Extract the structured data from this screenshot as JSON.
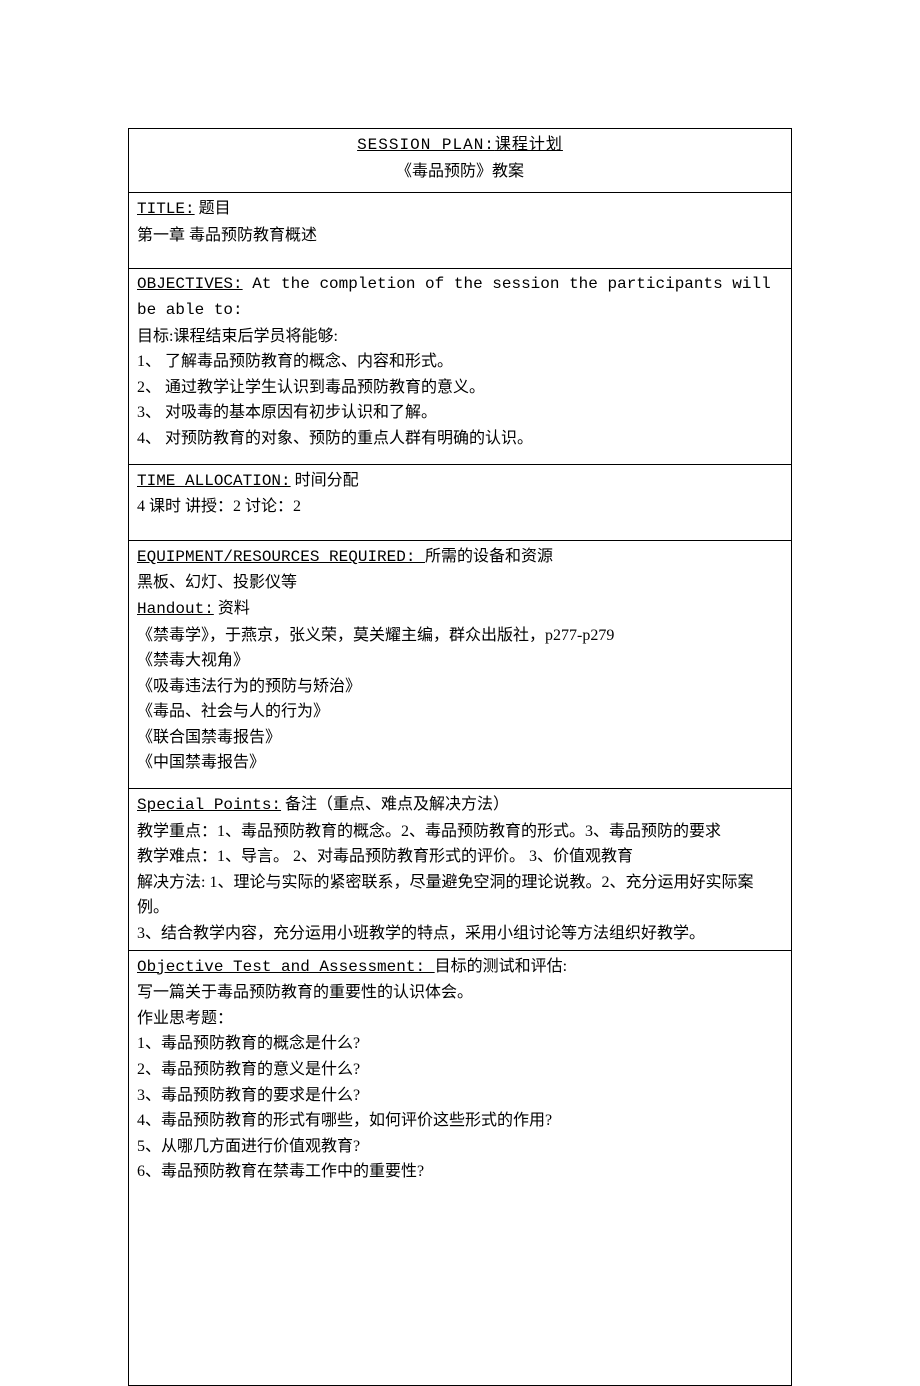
{
  "header": {
    "line1_pre": "SESSION   PLAN:",
    "line1_suf": "课程计划  ",
    "line2": "《毒品预防》教案"
  },
  "titleSection": {
    "label": "TITLE:",
    "label_cn": " 题目",
    "content": "第一章 毒品预防教育概述"
  },
  "objectivesSection": {
    "label": "OBJECTIVES:",
    "label_txt": " At the completion of the session the participants will be able to:",
    "sub": "目标:课程结束后学员将能够:",
    "items": [
      "1、 了解毒品预防教育的概念、内容和形式。",
      "2、 通过教学让学生认识到毒品预防教育的意义。",
      "3、 对吸毒的基本原因有初步认识和了解。",
      "4、 对预防教育的对象、预防的重点人群有明确的认识。"
    ]
  },
  "timeSection": {
    "label": "TIME  ALLOCATION:",
    "label_cn": " 时间分配",
    "content": "4 课时   讲授：2   讨论：2"
  },
  "equipSection": {
    "label": "EQUIPMENT/RESOURCES REQUIRED: ",
    "label_cn": "所需的设备和资源",
    "line1": "黑板、幻灯、投影仪等",
    "handout_label": "Handout:",
    "handout_cn": " 资料",
    "handouts": [
      "《禁毒学》，于燕京，张义荣，莫关耀主编，群众出版社，p277-p279",
      "《禁毒大视角》",
      "《吸毒违法行为的预防与矫治》",
      "《毒品、社会与人的行为》",
      "《联合国禁毒报告》",
      "《中国禁毒报告》"
    ]
  },
  "specialSection": {
    "label": "Special Points:",
    "label_cn": " 备注（重点、难点及解决方法）",
    "lines": [
      "教学重点：1、毒品预防教育的概念。2、毒品预防教育的形式。3、毒品预防的要求",
      "教学难点：1、导言。 2、对毒品预防教育形式的评价。 3、价值观教育",
      "解决方法: 1、理论与实际的紧密联系，尽量避免空洞的理论说教。2、充分运用好实际案例。",
      "3、结合教学内容，充分运用小班教学的特点，采用小组讨论等方法组织好教学。"
    ]
  },
  "assessSection": {
    "label": "Objective Test and Assessment: ",
    "label_cn": "目标的测试和评估:",
    "intro": "写一篇关于毒品预防教育的重要性的认识体会。",
    "sub": "作业思考题：",
    "items": [
      "1、毒品预防教育的概念是什么?",
      "2、毒品预防教育的意义是什么?",
      "3、毒品预防教育的要求是什么?",
      "4、毒品预防教育的形式有哪些，如何评价这些形式的作用?",
      "5、从哪几方面进行价值观教育?",
      "6、毒品预防教育在禁毒工作中的重要性?"
    ]
  }
}
